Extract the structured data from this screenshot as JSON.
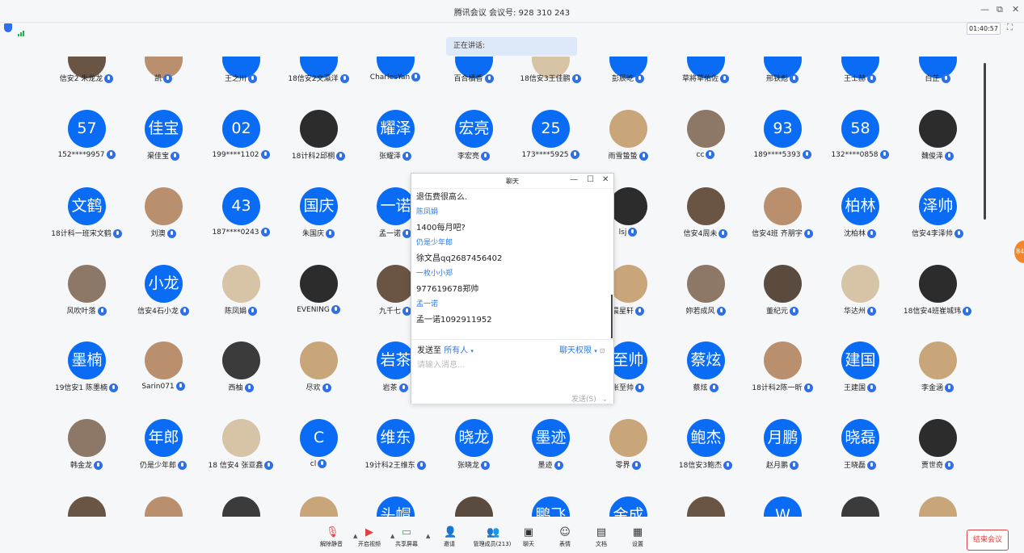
{
  "window": {
    "title": "腾讯会议 会议号: 928 310 243",
    "timer": "01:40:57"
  },
  "speaking": {
    "label": "正在讲话:"
  },
  "participants": [
    {
      "avatar": "",
      "name": "信安2 朱龙龙",
      "img": true
    },
    {
      "avatar": "",
      "name": "凯",
      "img": true
    },
    {
      "avatar": "",
      "name": "王之川",
      "img": false
    },
    {
      "avatar": "",
      "name": "18信安2文瀛洋",
      "img": false
    },
    {
      "avatar": "",
      "name": "CharlesYan",
      "img": false
    },
    {
      "avatar": "",
      "name": "百合橘香",
      "img": false
    },
    {
      "avatar": "",
      "name": "18信安3王佳鹏",
      "img": true
    },
    {
      "avatar": "",
      "name": "彭辰屹",
      "img": false
    },
    {
      "avatar": "",
      "name": "草將草佑佐",
      "img": false
    },
    {
      "avatar": "",
      "name": "邢铁彪",
      "img": false
    },
    {
      "avatar": "",
      "name": "王士赫",
      "img": false
    },
    {
      "avatar": "",
      "name": "白芷",
      "img": false
    },
    {
      "avatar": "57",
      "name": "152****9957",
      "img": false
    },
    {
      "avatar": "佳宝",
      "name": "渠佳宝",
      "img": false
    },
    {
      "avatar": "02",
      "name": "199****1102",
      "img": false
    },
    {
      "avatar": "",
      "name": "18计科2邱桐",
      "img": true
    },
    {
      "avatar": "耀泽",
      "name": "张耀泽",
      "img": false
    },
    {
      "avatar": "宏亮",
      "name": "李宏亮",
      "img": false
    },
    {
      "avatar": "25",
      "name": "173****5925",
      "img": false
    },
    {
      "avatar": "",
      "name": "雨雪蛰蛰",
      "img": true
    },
    {
      "avatar": "",
      "name": "cc",
      "img": true
    },
    {
      "avatar": "93",
      "name": "189****5393",
      "img": false
    },
    {
      "avatar": "58",
      "name": "132****0858",
      "img": false
    },
    {
      "avatar": "",
      "name": "魏俊泽",
      "img": true
    },
    {
      "avatar": "文鹤",
      "name": "18计科一班宋文鹤",
      "img": false
    },
    {
      "avatar": "",
      "name": "刘澳",
      "img": true
    },
    {
      "avatar": "43",
      "name": "187****0243",
      "img": false
    },
    {
      "avatar": "国庆",
      "name": "朱国庆",
      "img": false
    },
    {
      "avatar": "一诺",
      "name": "孟一诺",
      "img": false
    },
    {
      "avatar": "",
      "name": "",
      "img": false
    },
    {
      "avatar": "",
      "name": "",
      "img": false
    },
    {
      "avatar": "",
      "name": "lsj",
      "img": true
    },
    {
      "avatar": "",
      "name": "信安4周未",
      "img": true
    },
    {
      "avatar": "",
      "name": "信安4班 齐朋宇",
      "img": true
    },
    {
      "avatar": "柏林",
      "name": "沈柏林",
      "img": false
    },
    {
      "avatar": "泽帅",
      "name": "信安4李泽帅",
      "img": false
    },
    {
      "avatar": "",
      "name": "风吹叶落",
      "img": true
    },
    {
      "avatar": "小龙",
      "name": "信安4石小龙",
      "img": false
    },
    {
      "avatar": "",
      "name": "陈凤娟",
      "img": true
    },
    {
      "avatar": "",
      "name": "EVENING",
      "img": true
    },
    {
      "avatar": "",
      "name": "九千七",
      "img": true
    },
    {
      "avatar": "",
      "name": "",
      "img": false
    },
    {
      "avatar": "",
      "name": "",
      "img": false
    },
    {
      "avatar": "",
      "name": "晨星轩",
      "img": true
    },
    {
      "avatar": "",
      "name": "妳若成风",
      "img": true
    },
    {
      "avatar": "",
      "name": "董纪元",
      "img": true
    },
    {
      "avatar": "",
      "name": "华达州",
      "img": true
    },
    {
      "avatar": "",
      "name": "18信安4班崔城玮",
      "img": true
    },
    {
      "avatar": "墨楠",
      "name": "19信安1 陈墨楠",
      "img": false
    },
    {
      "avatar": "",
      "name": "Sarin071",
      "img": true
    },
    {
      "avatar": "",
      "name": "西柚",
      "img": true
    },
    {
      "avatar": "",
      "name": "尽欢",
      "img": true
    },
    {
      "avatar": "岩茶",
      "name": "岩茶",
      "img": false
    },
    {
      "avatar": "",
      "name": "",
      "img": false
    },
    {
      "avatar": "",
      "name": "",
      "img": false
    },
    {
      "avatar": "至帅",
      "name": "张至帅",
      "img": false
    },
    {
      "avatar": "蔡炫",
      "name": "蔡炫",
      "img": false
    },
    {
      "avatar": "",
      "name": "18计科2陈一昕",
      "img": true
    },
    {
      "avatar": "建国",
      "name": "王建国",
      "img": false
    },
    {
      "avatar": "",
      "name": "李金涵",
      "img": true
    },
    {
      "avatar": "",
      "name": "韩金龙",
      "img": true
    },
    {
      "avatar": "年郎",
      "name": "仍是少年郎",
      "img": false
    },
    {
      "avatar": "",
      "name": "18 信安4 张亚鑫",
      "img": true
    },
    {
      "avatar": "C",
      "name": "cl",
      "img": false
    },
    {
      "avatar": "维东",
      "name": "19计科2王维东",
      "img": false
    },
    {
      "avatar": "晓龙",
      "name": "张晓龙",
      "img": false
    },
    {
      "avatar": "墨迹",
      "name": "墨迹",
      "img": false
    },
    {
      "avatar": "",
      "name": "零界",
      "img": true
    },
    {
      "avatar": "鲍杰",
      "name": "18信安3鲍杰",
      "img": false
    },
    {
      "avatar": "月鹏",
      "name": "赵月鹏",
      "img": false
    },
    {
      "avatar": "晓磊",
      "name": "王晓磊",
      "img": false
    },
    {
      "avatar": "",
      "name": "贾世奇",
      "img": true
    },
    {
      "avatar": "",
      "name": "",
      "img": true
    },
    {
      "avatar": "",
      "name": "",
      "img": true
    },
    {
      "avatar": "",
      "name": "",
      "img": true
    },
    {
      "avatar": "",
      "name": "",
      "img": true
    },
    {
      "avatar": "头帽",
      "name": "",
      "img": false
    },
    {
      "avatar": "",
      "name": "",
      "img": true
    },
    {
      "avatar": "鹏飞",
      "name": "",
      "img": false
    },
    {
      "avatar": "金成",
      "name": "",
      "img": false
    },
    {
      "avatar": "",
      "name": "",
      "img": true
    },
    {
      "avatar": "W",
      "name": "",
      "img": false
    },
    {
      "avatar": "",
      "name": "",
      "img": true
    },
    {
      "avatar": "",
      "name": "",
      "img": true
    }
  ],
  "chat": {
    "title": "聊天",
    "messages": [
      {
        "type": "text",
        "value": "退伍费很高么."
      },
      {
        "type": "sender",
        "value": "陈凤娟"
      },
      {
        "type": "text",
        "value": "1400每月吧?"
      },
      {
        "type": "sender",
        "value": "仍是少年郎"
      },
      {
        "type": "text",
        "value": "徐文昌qq2687456402"
      },
      {
        "type": "sender",
        "value": "一枚小小郑"
      },
      {
        "type": "text",
        "value": "977619678郑帅"
      },
      {
        "type": "sender",
        "value": "孟一诺"
      },
      {
        "type": "text",
        "value": "孟一诺1092911952"
      }
    ],
    "send_to_label": "发送至",
    "send_to_value": "所有人",
    "permission_label": "聊天权限",
    "input_placeholder": "请输入消息...",
    "send_button": "发送(S)"
  },
  "toolbar": {
    "items": [
      {
        "label": "解除静音",
        "icon": "mic-muted-icon"
      },
      {
        "label": "开启视频",
        "icon": "camera-off-icon"
      },
      {
        "label": "共享屏幕",
        "icon": "share-screen-icon"
      },
      {
        "label": "邀请",
        "icon": "invite-icon"
      },
      {
        "label": "管理成员(213)",
        "icon": "members-icon"
      },
      {
        "label": "聊天",
        "icon": "chat-icon"
      },
      {
        "label": "表情",
        "icon": "emoji-icon"
      },
      {
        "label": "文档",
        "icon": "document-icon"
      },
      {
        "label": "设置",
        "icon": "settings-icon"
      }
    ],
    "end_meeting": "结束会议"
  },
  "colors": {
    "accent": "#0a6cf4",
    "end": "#e04040",
    "signal": "#22b14c"
  }
}
